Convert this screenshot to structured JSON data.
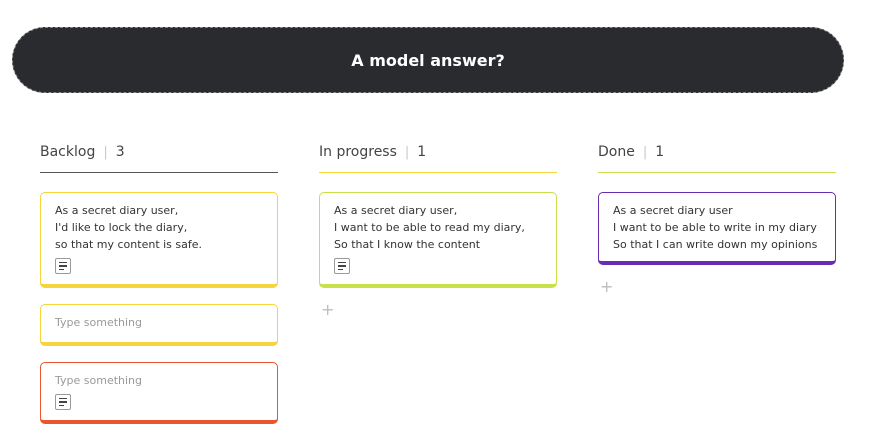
{
  "header": {
    "title": "A model answer?"
  },
  "colors": {
    "header_bg": "#2a2b2f",
    "yellow": "#f5d53b",
    "lime": "#c9e04a",
    "purple": "#6a2bb3",
    "red": "#e8562e"
  },
  "columns": [
    {
      "title": "Backlog",
      "count": "3",
      "cards": [
        {
          "lines": [
            "As a secret diary user,",
            "I'd like to lock the diary,",
            "so that my content is safe."
          ],
          "has_note_icon": true
        },
        {
          "placeholder": "Type something",
          "has_note_icon": false
        },
        {
          "placeholder": "Type something",
          "has_note_icon": true
        }
      ]
    },
    {
      "title": "In progress",
      "count": "1",
      "cards": [
        {
          "lines": [
            "As a secret diary user,",
            "I want to be able to read my diary,",
            "So that I know the content"
          ],
          "has_note_icon": true
        }
      ],
      "add_label": "+"
    },
    {
      "title": "Done",
      "count": "1",
      "cards": [
        {
          "lines": [
            "As a secret diary user",
            "I want to be able to write in my diary",
            "So that I can write down my opinions"
          ],
          "has_note_icon": false
        }
      ],
      "add_label": "+"
    }
  ]
}
